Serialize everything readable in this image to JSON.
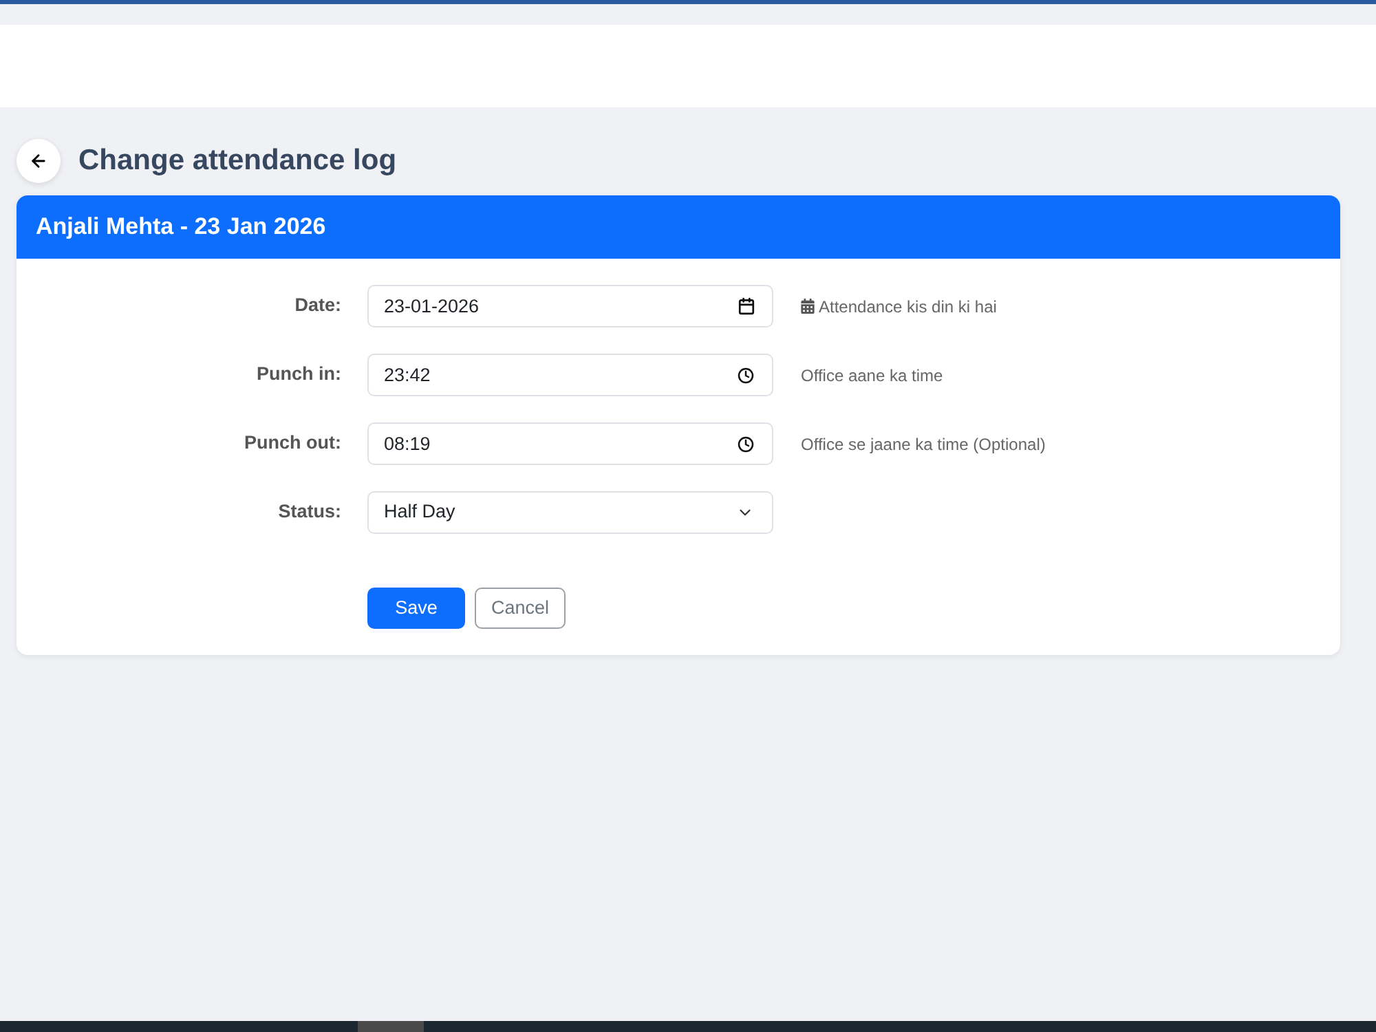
{
  "page": {
    "title": "Change attendance log"
  },
  "card": {
    "header": "Anjali Mehta - 23 Jan 2026",
    "fields": [
      {
        "kind": "date",
        "label": "Date:",
        "value": "23-01-2026",
        "help": "Attendance kis din ki hai",
        "help_icon": true
      },
      {
        "kind": "time",
        "label": "Punch in:",
        "value": "23:42",
        "help": "Office aane ka time",
        "help_icon": false
      },
      {
        "kind": "time",
        "label": "Punch out:",
        "value": "08:19",
        "help": "Office se jaane ka time (Optional)",
        "help_icon": false
      },
      {
        "kind": "select",
        "label": "Status:",
        "value": "Half Day"
      }
    ],
    "buttons": [
      {
        "kind": "primary",
        "label": "Save"
      },
      {
        "kind": "secondary",
        "label": "Cancel"
      }
    ]
  }
}
